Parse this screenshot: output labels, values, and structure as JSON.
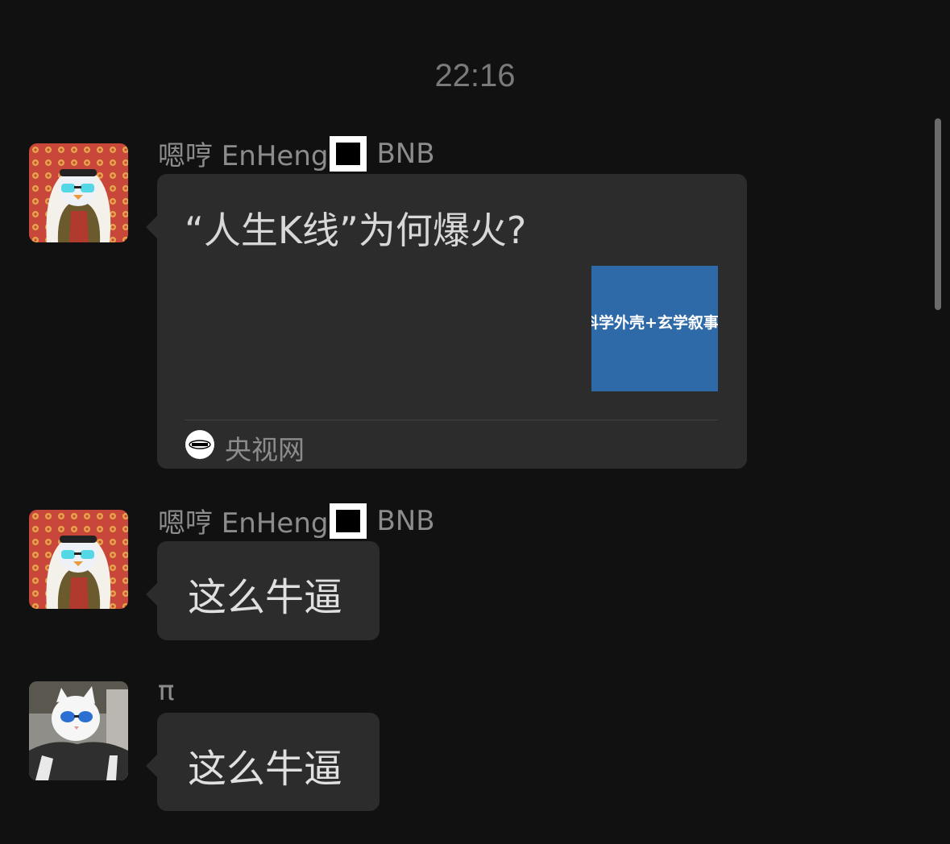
{
  "timestamp": "22:16",
  "messages": [
    {
      "sender": "嗯哼 EnHeng",
      "sender_suffix": "BNB",
      "avatar_icon": "arab-penguin-avatar",
      "type": "link-card",
      "card": {
        "title": "“人生K线”为何爆火?",
        "thumbnail_text": "科学外壳+玄学叙事",
        "source_icon": "cctv-logo-icon",
        "source_name": "央视网"
      }
    },
    {
      "sender": "嗯哼 EnHeng",
      "sender_suffix": "BNB",
      "avatar_icon": "arab-penguin-avatar",
      "type": "text",
      "text": "这么牛逼"
    },
    {
      "sender": "π",
      "avatar_icon": "cat-sunglasses-avatar",
      "type": "text",
      "text": "这么牛逼"
    }
  ],
  "colors": {
    "background": "#111111",
    "bubble": "#2c2c2c",
    "thumbnail": "#2f6aa8"
  }
}
